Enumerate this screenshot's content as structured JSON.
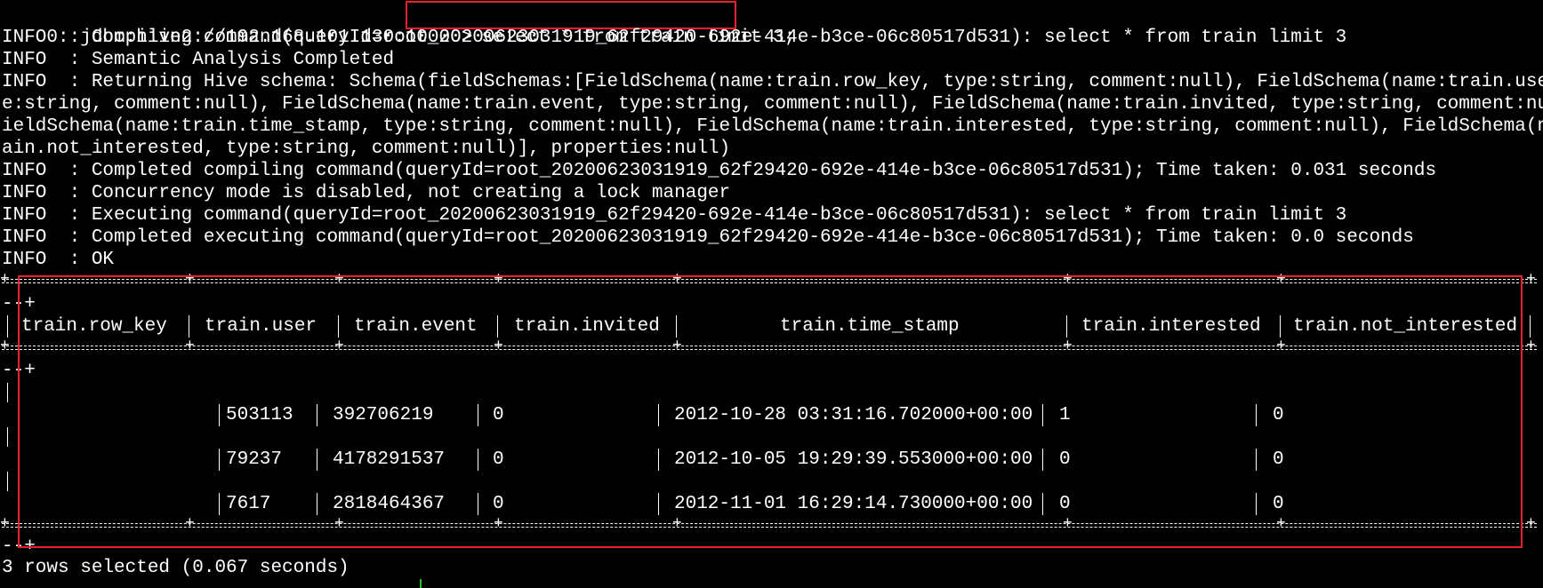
{
  "prompt": "0: jdbc:hive2://192.168.101.130:10000>",
  "command": "select * from train limit 3;",
  "log_lines": [
    "INFO  : Compiling command(queryId=root_20200623031919_62f29420-692e-414e-b3ce-06c80517d531): select * from train limit 3",
    "INFO  : Semantic Analysis Completed",
    "INFO  : Returning Hive schema: Schema(fieldSchemas:[FieldSchema(name:train.row_key, type:string, comment:null), FieldSchema(name:train.user, typ",
    "e:string, comment:null), FieldSchema(name:train.event, type:string, comment:null), FieldSchema(name:train.invited, type:string, comment:null), F",
    "ieldSchema(name:train.time_stamp, type:string, comment:null), FieldSchema(name:train.interested, type:string, comment:null), FieldSchema(name:tr",
    "ain.not_interested, type:string, comment:null)], properties:null)",
    "INFO  : Completed compiling command(queryId=root_20200623031919_62f29420-692e-414e-b3ce-06c80517d531); Time taken: 0.031 seconds",
    "INFO  : Concurrency mode is disabled, not creating a lock manager",
    "INFO  : Executing command(queryId=root_20200623031919_62f29420-692e-414e-b3ce-06c80517d531): select * from train limit 3",
    "INFO  : Completed executing command(queryId=root_20200623031919_62f29420-692e-414e-b3ce-06c80517d531); Time taken: 0.0 seconds",
    "INFO  : OK"
  ],
  "border_tail": "--+",
  "table": {
    "headers": [
      "train.row_key",
      "train.user",
      "train.event",
      "train.invited",
      "train.time_stamp",
      "train.interested",
      "train.not_interested"
    ],
    "rows": [
      [
        "503113",
        "392706219",
        "0",
        "2012-10-28 03:31:16.702000+00:00",
        "1",
        "0"
      ],
      [
        "79237",
        "4178291537",
        "0",
        "2012-10-05 19:29:39.553000+00:00",
        "0",
        "0"
      ],
      [
        "7617",
        "2818464367",
        "0",
        "2012-11-01 16:29:14.730000+00:00",
        "0",
        "0"
      ]
    ]
  },
  "footer": "3 rows selected (0.067 seconds)",
  "colors": {
    "background": "#000000",
    "text": "#ffffff",
    "highlight_box": "#e8212b",
    "cursor": "#1ec71e"
  }
}
